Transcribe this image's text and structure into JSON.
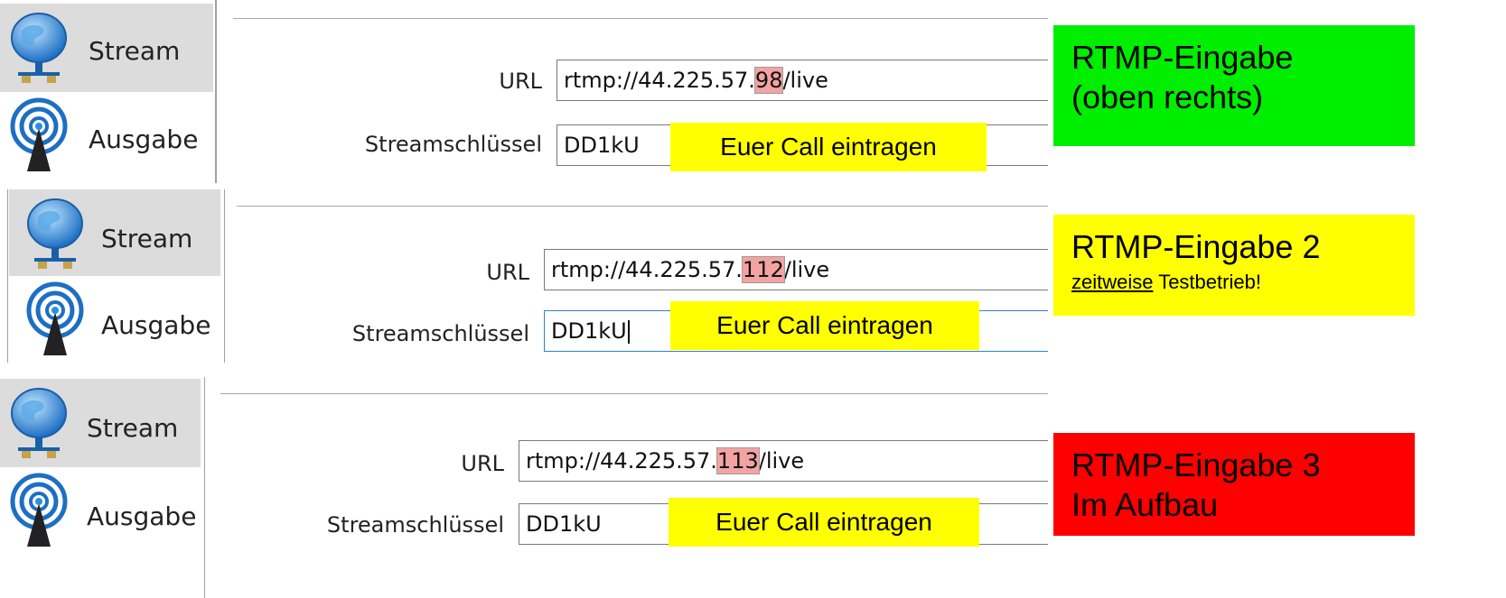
{
  "sidebar": {
    "stream_label": "Stream",
    "output_label": "Ausgabe"
  },
  "panels": [
    {
      "url_label": "URL",
      "url_prefix": "rtmp://44.225.57.",
      "url_highlight": "98",
      "url_suffix": "/live",
      "key_label": "Streamschlüssel",
      "key_value": "DD1kU",
      "callout": "Euer Call eintragen"
    },
    {
      "url_label": "URL",
      "url_prefix": "rtmp://44.225.57.",
      "url_highlight": "112",
      "url_suffix": "/live",
      "key_label": "Streamschlüssel",
      "key_value": "DD1kU",
      "callout": "Euer Call eintragen"
    },
    {
      "url_label": "URL",
      "url_prefix": "rtmp://44.225.57.",
      "url_highlight": "113",
      "url_suffix": "/live",
      "key_label": "Streamschlüssel",
      "key_value": "DD1kU",
      "callout": "Euer Call eintragen"
    }
  ],
  "boxes": [
    {
      "line1": "RTMP-Eingabe",
      "line2": "(oben rechts)",
      "color": "#00ee00"
    },
    {
      "line1": "RTMP-Eingabe 2",
      "note_underlined": "zeitweise",
      "note_rest": " Testbetrieb!",
      "color": "#ffff00"
    },
    {
      "line1": "RTMP-Eingabe 3",
      "line2": "Im Aufbau",
      "color": "#ff0000"
    }
  ],
  "icons": {
    "stream": "globe-network-icon",
    "output": "broadcast-antenna-icon"
  }
}
